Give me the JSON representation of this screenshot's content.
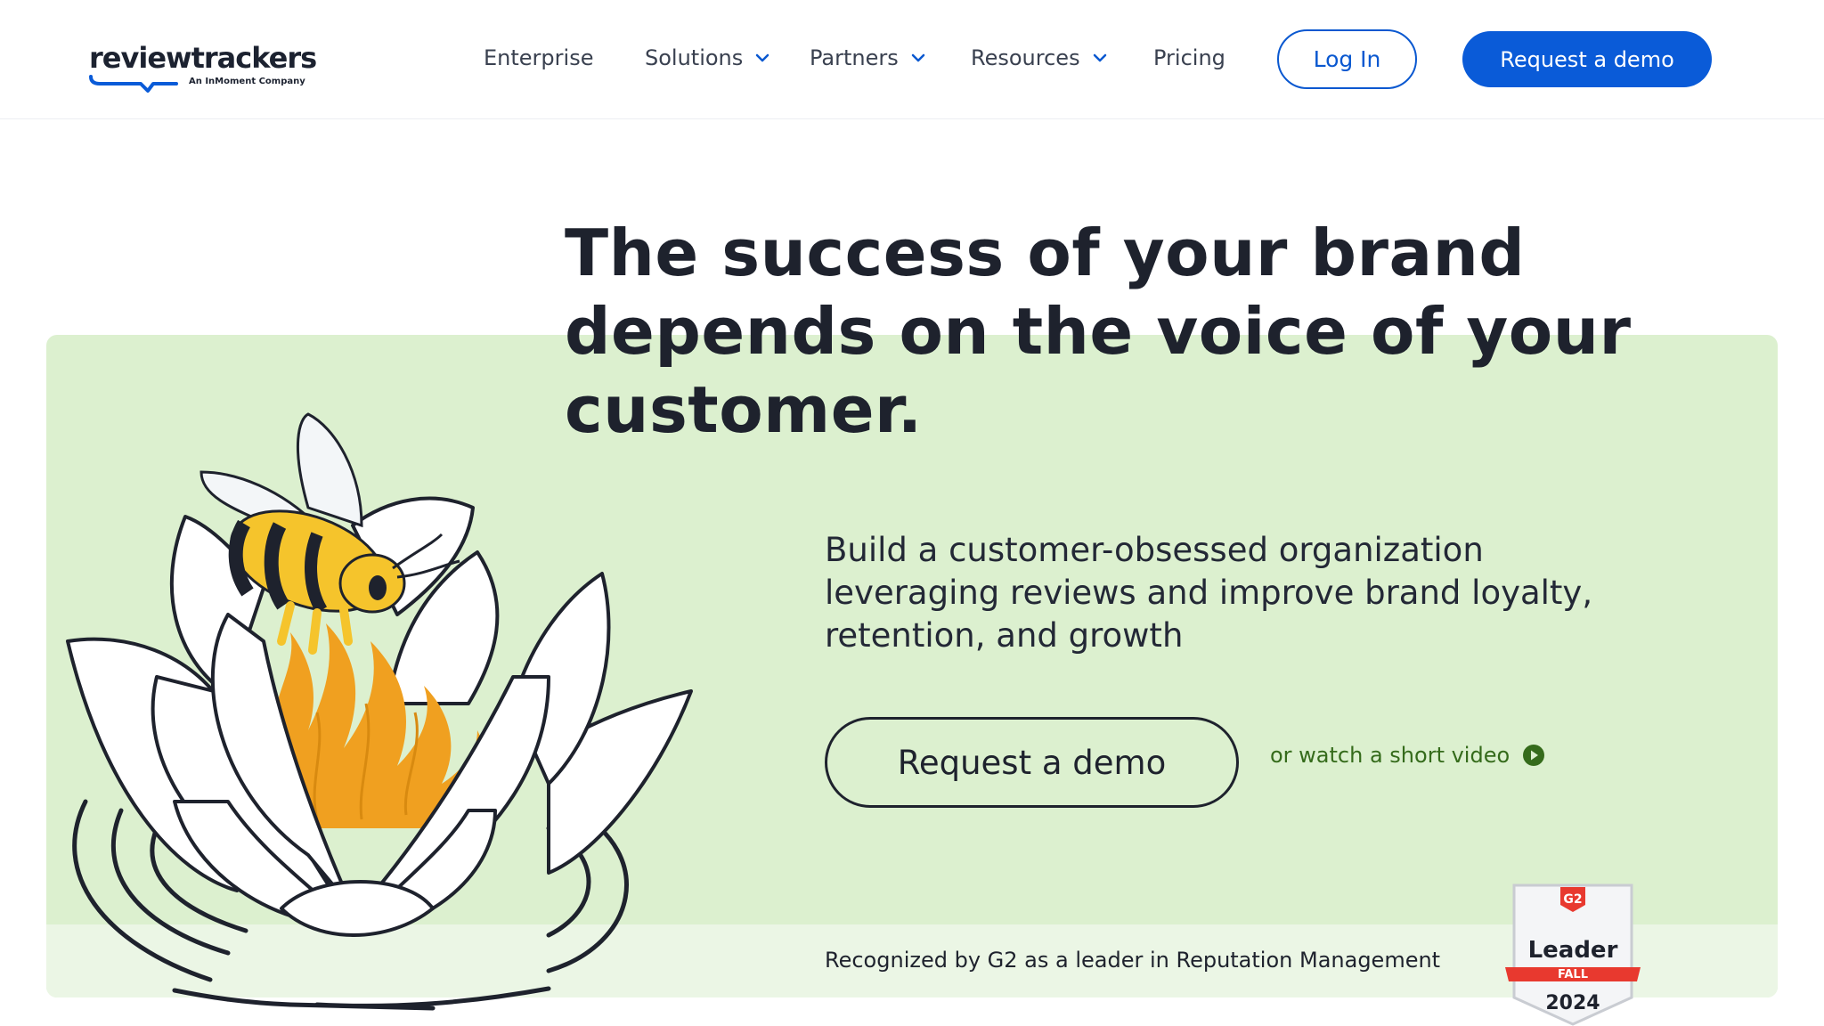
{
  "header": {
    "logo_text": "reviewtrackers",
    "logo_subtext": "An InMoment Company",
    "nav": [
      {
        "label": "Enterprise",
        "has_dropdown": false
      },
      {
        "label": "Solutions",
        "has_dropdown": true
      },
      {
        "label": "Partners",
        "has_dropdown": true
      },
      {
        "label": "Resources",
        "has_dropdown": true
      },
      {
        "label": "Pricing",
        "has_dropdown": false
      }
    ],
    "login_label": "Log In",
    "demo_label": "Request a demo"
  },
  "hero": {
    "headline_lines": [
      "The success of your brand",
      "depends on the voice of your",
      "customer."
    ],
    "subcopy_lines": [
      "Build a customer-obsessed organization",
      "leveraging reviews and improve brand loyalty,",
      "retention, and growth"
    ],
    "cta_label": "Request a demo",
    "video_link": "or watch a short video",
    "recognition_text": "Recognized by G2 as a leader in Reputation Management"
  },
  "badge": {
    "brand": "G2",
    "title": "Leader",
    "season": "FALL",
    "year": "2024"
  },
  "colors": {
    "brand_blue": "#0a5bd8",
    "hero_green": "#dcf0cf",
    "hero_strip": "#ebf6e5",
    "link_green": "#356b1b",
    "flame_orange": "#f0a020",
    "bee_yellow": "#f5c42c",
    "badge_red": "#e8392f"
  }
}
